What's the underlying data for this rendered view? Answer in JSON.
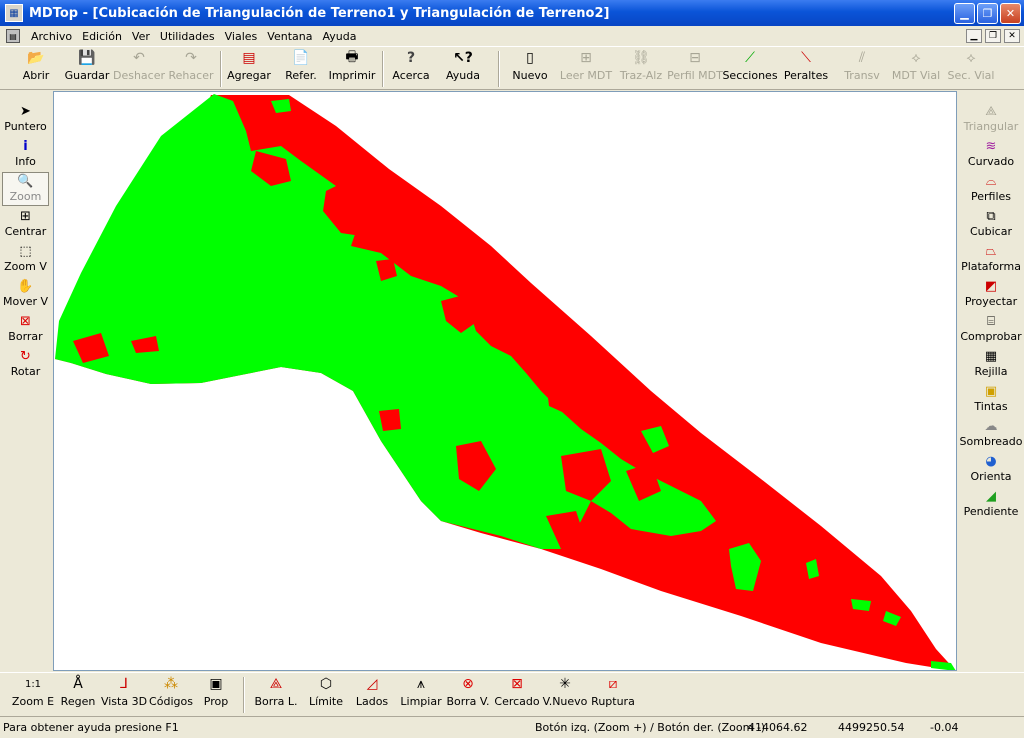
{
  "window": {
    "title": "MDTop - [Cubicación de Triangulación de Terreno1 y Triangulación de Terreno2]",
    "controls": [
      "minimize-icon",
      "maximize-icon",
      "close-icon"
    ]
  },
  "menu": [
    "Archivo",
    "Edición",
    "Ver",
    "Utilidades",
    "Viales",
    "Ventana",
    "Ayuda"
  ],
  "toolbar": [
    {
      "label": "Abrir",
      "icon": "open-folder-icon",
      "enabled": true
    },
    {
      "label": "Guardar",
      "icon": "save-disk-icon",
      "enabled": true
    },
    {
      "label": "Deshacer",
      "icon": "undo-icon",
      "enabled": false
    },
    {
      "label": "Rehacer",
      "icon": "redo-icon",
      "enabled": false
    },
    {
      "label": "Agregar",
      "icon": "add-file-icon",
      "enabled": true
    },
    {
      "label": "Refer.",
      "icon": "reference-icon",
      "enabled": true
    },
    {
      "label": "Imprimir",
      "icon": "printer-icon",
      "enabled": true
    },
    {
      "label": "Acerca",
      "icon": "about-icon",
      "enabled": true
    },
    {
      "label": "Ayuda",
      "icon": "help-icon",
      "enabled": true
    },
    {
      "label": "Nuevo",
      "icon": "new-icon",
      "enabled": true
    },
    {
      "label": "Leer MDT",
      "icon": "read-mdt-icon",
      "enabled": false
    },
    {
      "label": "Traz-Alz",
      "icon": "alignment-icon",
      "enabled": false
    },
    {
      "label": "Perfil MDT",
      "icon": "profile-mdt-icon",
      "enabled": false
    },
    {
      "label": "Secciones",
      "icon": "sections-icon",
      "enabled": true
    },
    {
      "label": "Peraltes",
      "icon": "superelevation-icon",
      "enabled": true
    },
    {
      "label": "Transv",
      "icon": "transversal-icon",
      "enabled": false
    },
    {
      "label": "MDT Vial",
      "icon": "road-mdt-icon",
      "enabled": false
    },
    {
      "label": "Sec. Vial",
      "icon": "road-section-icon",
      "enabled": false
    }
  ],
  "left_tools": [
    {
      "label": "Puntero",
      "icon": "pointer-icon"
    },
    {
      "label": "Info",
      "icon": "info-icon"
    },
    {
      "label": "Zoom",
      "icon": "zoom-magnifier-icon",
      "selected": true
    },
    {
      "label": "Centrar",
      "icon": "center-icon"
    },
    {
      "label": "Zoom V",
      "icon": "zoom-window-icon"
    },
    {
      "label": "Mover V",
      "icon": "pan-hand-icon"
    },
    {
      "label": "Borrar",
      "icon": "erase-icon"
    },
    {
      "label": "Rotar",
      "icon": "rotate-icon"
    }
  ],
  "right_tools": [
    {
      "label": "Triangular",
      "icon": "triangulate-icon",
      "enabled": false
    },
    {
      "label": "Curvado",
      "icon": "contour-icon",
      "enabled": true
    },
    {
      "label": "Perfiles",
      "icon": "profiles-icon",
      "enabled": true
    },
    {
      "label": "Cubicar",
      "icon": "volume-cube-icon",
      "enabled": true
    },
    {
      "label": "Plataforma",
      "icon": "platform-icon",
      "enabled": true
    },
    {
      "label": "Proyectar",
      "icon": "project-icon",
      "enabled": true
    },
    {
      "label": "Comprobar",
      "icon": "check-icon",
      "enabled": true
    },
    {
      "label": "Rejilla",
      "icon": "grid-icon",
      "enabled": true
    },
    {
      "label": "Tintas",
      "icon": "tints-icon",
      "enabled": true
    },
    {
      "label": "Sombreado",
      "icon": "shading-icon",
      "enabled": true
    },
    {
      "label": "Orienta",
      "icon": "orientation-wheel-icon",
      "enabled": true
    },
    {
      "label": "Pendiente",
      "icon": "slope-icon",
      "enabled": true
    }
  ],
  "bottom_tools": [
    {
      "label": "Zoom E",
      "icon": "zoom-1to1-icon"
    },
    {
      "label": "Regen",
      "icon": "regen-icon"
    },
    {
      "label": "Vista 3D",
      "icon": "view-3d-icon"
    },
    {
      "label": "Códigos",
      "icon": "codes-icon"
    },
    {
      "label": "Prop",
      "icon": "properties-icon"
    },
    {
      "label": "Borra L.",
      "icon": "erase-lines-icon"
    },
    {
      "label": "Límite",
      "icon": "limit-icon"
    },
    {
      "label": "Lados",
      "icon": "sides-icon"
    },
    {
      "label": "Limpiar",
      "icon": "clean-icon"
    },
    {
      "label": "Borra V.",
      "icon": "erase-vertex-icon"
    },
    {
      "label": "Cercado",
      "icon": "fence-icon"
    },
    {
      "label": "V.Nuevo",
      "icon": "new-vertex-icon"
    },
    {
      "label": "Ruptura",
      "icon": "breakline-icon"
    }
  ],
  "status": {
    "help": "Para obtener ayuda presione F1",
    "mouse_hint": "Botón izq. (Zoom +) / Botón der. (Zoom -)",
    "x": "414064.62",
    "y": "4499250.54",
    "z": "-0.04"
  },
  "map_colors": {
    "cut": "#ff0000",
    "fill": "#00ff00",
    "background": "#ffffff"
  }
}
